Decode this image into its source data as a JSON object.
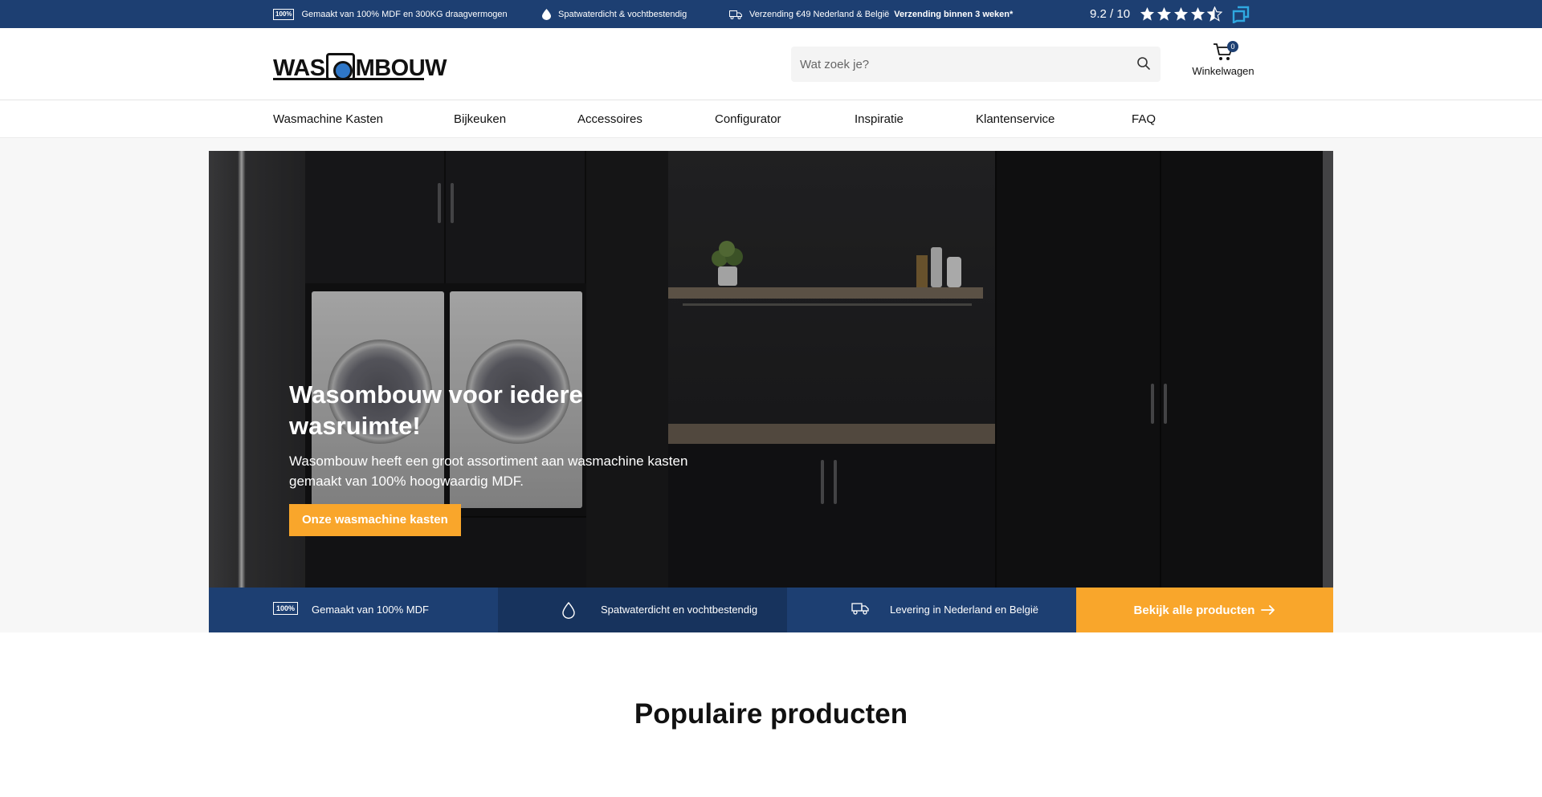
{
  "topbar": {
    "usp1": {
      "badge": "100%",
      "text": "Gemaakt van 100% MDF en 300KG draagvermogen"
    },
    "usp2": {
      "text": "Spatwaterdicht & vochtbestendig"
    },
    "usp3": {
      "text": "Verzending €49 Nederland & België",
      "bold": "Verzending binnen 3 weken*"
    },
    "rating": {
      "score": "9.2 / 10",
      "stars": 4.5
    }
  },
  "header": {
    "logo": {
      "left": "WAS",
      "right": "MBOUW"
    },
    "search": {
      "placeholder": "Wat zoek je?"
    },
    "cart": {
      "count": "0",
      "label": "Winkelwagen"
    }
  },
  "nav": {
    "items": [
      {
        "label": "Wasmachine Kasten"
      },
      {
        "label": "Bijkeuken"
      },
      {
        "label": "Accessoires"
      },
      {
        "label": "Configurator"
      },
      {
        "label": "Inspiratie"
      },
      {
        "label": "Klantenservice"
      },
      {
        "label": "FAQ"
      }
    ]
  },
  "hero": {
    "title": "Wasombouw voor iedere wasruimte!",
    "subtitle": "Wasombouw heeft een groot assortiment aan wasmachine kasten gemaakt van 100% hoogwaardig MDF.",
    "button": "Onze wasmachine kasten"
  },
  "usp_strip": {
    "items": [
      {
        "badge": "100%",
        "text": "Gemaakt van 100% MDF"
      },
      {
        "text": "Spatwaterdicht en vochtbestendig"
      },
      {
        "text": "Levering in Nederland en België"
      }
    ],
    "cta": "Bekijk alle producten"
  },
  "section": {
    "title": "Populaire producten"
  },
  "colors": {
    "navy": "#1d3f72",
    "navy_dark": "#17335d",
    "orange": "#f9a62b",
    "kiyoh_blue": "#2fa8e0"
  }
}
